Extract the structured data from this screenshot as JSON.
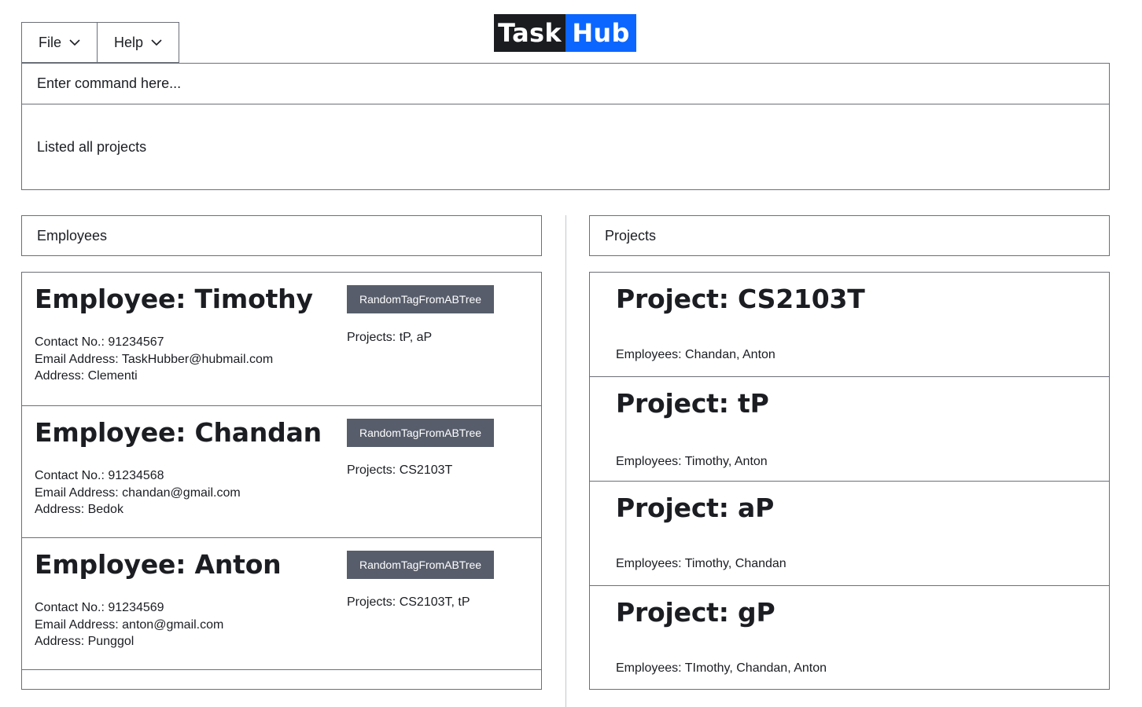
{
  "menu": {
    "file_label": "File",
    "help_label": "Help"
  },
  "logo": {
    "part1": "Task",
    "part2": "Hub",
    "colors": {
      "part1_bg": "#1a1c20",
      "part2_bg": "#0b66ff"
    }
  },
  "command": {
    "placeholder": "Enter command here...",
    "value": ""
  },
  "result": {
    "text": "Listed all projects"
  },
  "employees_panel": {
    "title": "Employees",
    "items": [
      {
        "name": "Employee: Timothy",
        "contact": "Contact No.: 91234567",
        "email": "Email Address: TaskHubber@hubmail.com",
        "address": "Address: Clementi",
        "tag": "RandomTagFromABTree",
        "projects": "Projects: tP, aP"
      },
      {
        "name": "Employee: Chandan",
        "contact": "Contact No.: 91234568",
        "email": "Email Address: chandan@gmail.com",
        "address": "Address: Bedok",
        "tag": "RandomTagFromABTree",
        "projects": "Projects: CS2103T"
      },
      {
        "name": "Employee: Anton",
        "contact": "Contact No.: 91234569",
        "email": "Email Address: anton@gmail.com",
        "address": "Address: Punggol",
        "tag": "RandomTagFromABTree",
        "projects": "Projects: CS2103T, tP"
      }
    ]
  },
  "projects_panel": {
    "title": "Projects",
    "items": [
      {
        "name": "Project: CS2103T",
        "employees": "Employees: Chandan, Anton"
      },
      {
        "name": "Project: tP",
        "employees": "Employees: Timothy, Anton"
      },
      {
        "name": "Project: aP",
        "employees": "Employees: Timothy, Chandan"
      },
      {
        "name": "Project: gP",
        "employees": "Employees: TImothy, Chandan, Anton"
      }
    ]
  },
  "colors": {
    "border": "#6b6f78",
    "tag_bg": "#575d6b",
    "text": "#1b1d22"
  }
}
